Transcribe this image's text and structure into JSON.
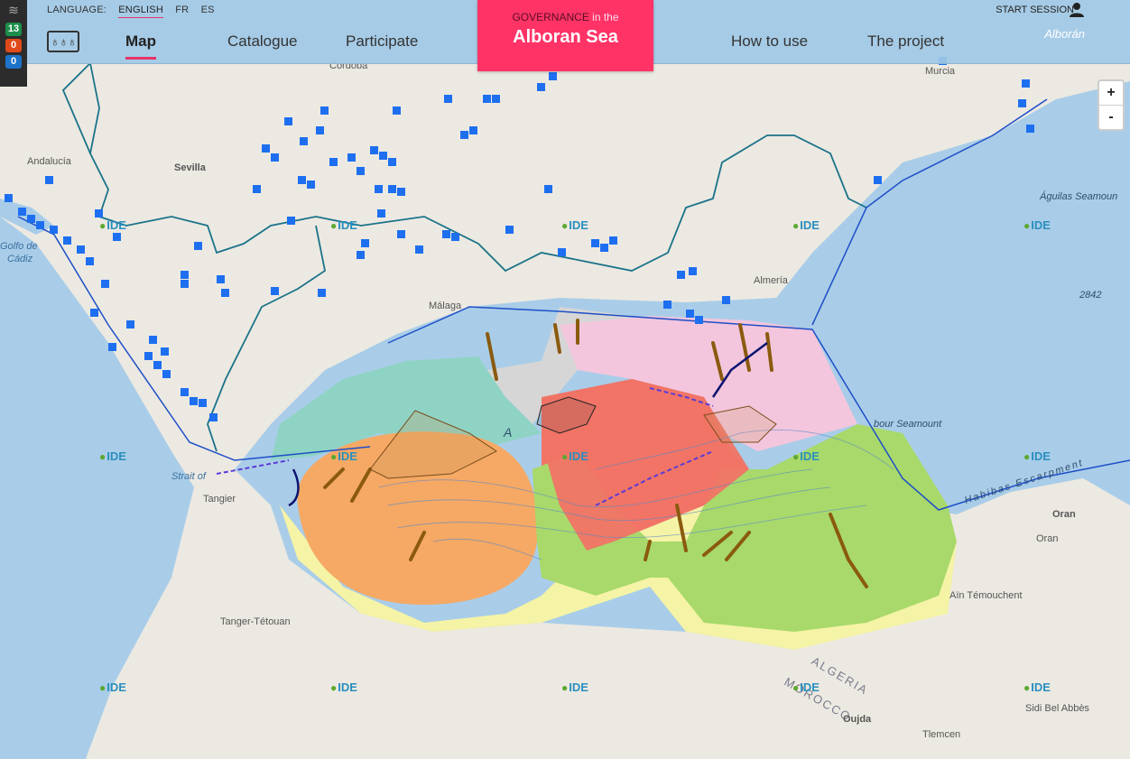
{
  "layer_panel": {
    "stack_icon": "layers-icon",
    "counts": [
      "13",
      "0",
      "0"
    ]
  },
  "header": {
    "language_label": "LANGUAGE:",
    "languages": [
      "ENGLISH",
      "FR",
      "ES"
    ],
    "nav": {
      "map": "Map",
      "catalogue": "Catalogue",
      "participate": "Participate",
      "how_to_use": "How to use",
      "project": "The project"
    },
    "brand": {
      "line1_a": "GOVERNANCE",
      "line1_b": " in the",
      "line2": "Alboran Sea"
    },
    "session": "START SESSION",
    "alboran_logo": "Alborán"
  },
  "zoom": {
    "in": "+",
    "out": "-"
  },
  "map_labels": {
    "cordoba": "Córdoba",
    "murcia": "Murcia",
    "andalucia": "Andalucía",
    "sevilla": "Sevilla",
    "golfo1": "Golfo de",
    "golfo2": "Cádiz",
    "aguilas": "Águilas Seamoun",
    "n2842": "2842",
    "malaga": "Málaga",
    "almeria": "Almería",
    "strait": "Strait of",
    "tangier": "Tangier",
    "seamount": "bour Seamount",
    "habibas": "Habibas Escarpment",
    "oran1": "Oran",
    "oran2": "Oran",
    "ain": "Aïn Témouchent",
    "tanger_tetouan": "Tanger-Tétouan",
    "algeria": "ALGERIA",
    "morocco": "MOROCCO",
    "oujda": "Oujda",
    "tlemcen": "Tlemcen",
    "sidi": "Sidi Bel Abbès",
    "alboran_a": "A"
  },
  "ide_label": "IDE",
  "colors": {
    "header_bg": "#a0c8e6",
    "brand": "#ff3366",
    "sea": "#a9cde8",
    "land": "#ece9e2",
    "orange_zone": "#f5a964",
    "green_zone": "#a8d96a",
    "red_zone": "#f07466",
    "pink_zone": "#f3c6dd",
    "teal_zone": "#8fd3c5",
    "grey_zone": "#d6d6d6",
    "yellow_zone": "#f5f3a6",
    "marker_blue": "#1e6ff0"
  }
}
